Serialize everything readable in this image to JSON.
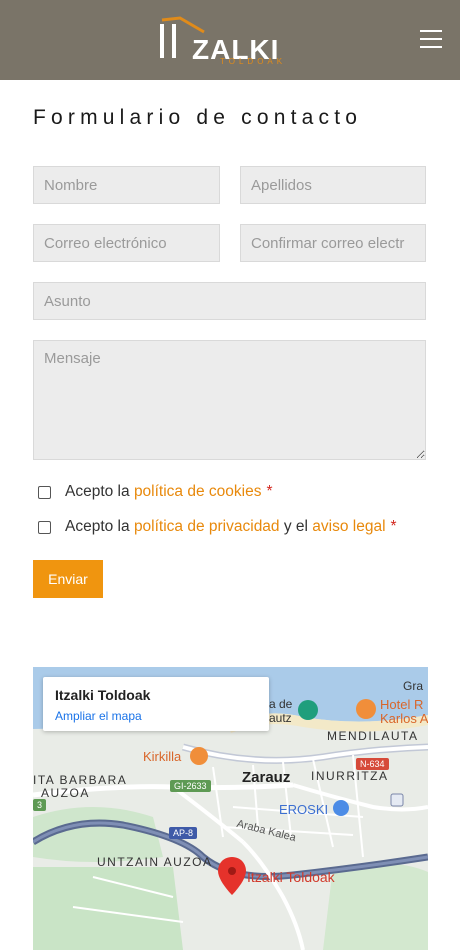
{
  "header": {
    "logo_text": "ZALKI",
    "logo_subtext": "TOLDOAK",
    "menu_icon": "hamburger-icon"
  },
  "form": {
    "title": "Formulario de contacto",
    "nombre_placeholder": "Nombre",
    "apellidos_placeholder": "Apellidos",
    "email_placeholder": "Correo electrónico",
    "confirm_email_placeholder": "Confirmar correo electr",
    "asunto_placeholder": "Asunto",
    "mensaje_placeholder": "Mensaje",
    "cookies": {
      "prefix": "Acepto la ",
      "link": "política de cookies",
      "required": "*"
    },
    "privacy": {
      "prefix": "Acepto la ",
      "link": "política de privacidad",
      "middle": " y el ",
      "link2": "aviso legal",
      "required": "*"
    },
    "submit_label": "Enviar"
  },
  "map": {
    "card_title": "Itzalki Toldoak",
    "card_link": "Ampliar el mapa",
    "place_label": "Itzalki Toldoak",
    "labels": {
      "town": "Zarauz",
      "mendilauta": "MENDILAUTA",
      "inurritza": "INURRITZA",
      "santa_barbara_1": "ITA BARBARA",
      "santa_barbara_2": "AUZOA",
      "untzain": "UNTZAIN AUZOA",
      "kirkilla": "Kirkilla",
      "eroski": "EROSKI",
      "hotel_1": "Hotel R",
      "hotel_2": "Karlos A",
      "park_1": "a de",
      "park_2": "autz",
      "gra": "Gra",
      "araba": "Araba Kalea",
      "road_gi": "GI-2633",
      "road_ap": "AP-8",
      "road_n": "N-634",
      "road_3": "3"
    },
    "colors": {
      "water": "#a9c8e8",
      "green": "#c6e3c4",
      "road": "#ffffff",
      "highway": "#4c5b82",
      "pin": "#e5322b"
    }
  }
}
